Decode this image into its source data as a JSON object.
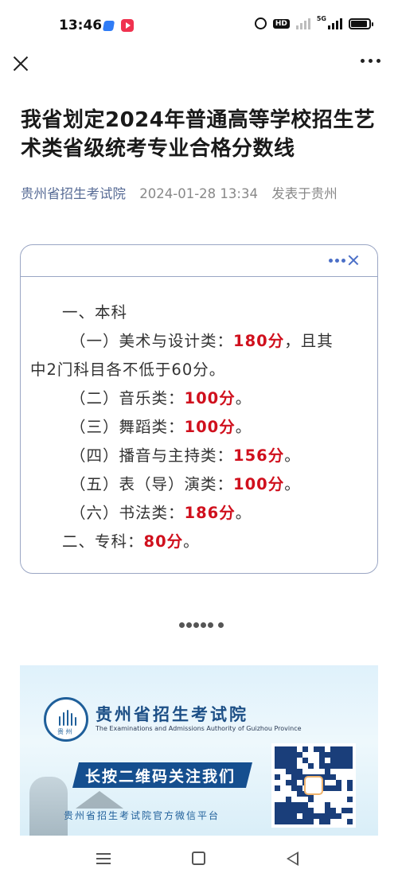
{
  "status_bar": {
    "time": "13:46",
    "hd_label": "HD",
    "network_label": "5G",
    "battery_level": 0.9
  },
  "article": {
    "title": "我省划定2024年普通高等学校招生艺术类省级统考专业合格分数线",
    "source": "贵州省招生考试院",
    "date": "2024-01-28 13:34",
    "location": "发表于贵州"
  },
  "card": {
    "lines": [
      {
        "text": "一、本科",
        "score": "",
        "suffix": ""
      },
      {
        "text": "（一）美术与设计类：",
        "score": "180分",
        "suffix": "，且其"
      },
      {
        "text": "中2门科目各不低于60分。",
        "score": "",
        "suffix": ""
      },
      {
        "text": "（二）音乐类：",
        "score": "100分",
        "suffix": "。"
      },
      {
        "text": "（三）舞蹈类：",
        "score": "100分",
        "suffix": "。"
      },
      {
        "text": "（四）播音与主持类：",
        "score": "156分",
        "suffix": "。"
      },
      {
        "text": "（五）表（导）演类：",
        "score": "100分",
        "suffix": "。"
      },
      {
        "text": "（六）书法类：",
        "score": "186分",
        "suffix": "。"
      },
      {
        "text": "二、专科：",
        "score": "80分",
        "suffix": "。"
      }
    ]
  },
  "banner": {
    "org_name": "贵州省招生考试院",
    "org_name_en": "The Examinations and Admissions Authority of Guizhou Province",
    "logo_text": "贵 州",
    "cta": "长按二维码关注我们",
    "footer": "贵州省招生考试院官方微信平台"
  },
  "colors": {
    "score": "#d0101d",
    "source_link": "#576b95",
    "card_border": "#9aa6c4",
    "brand_blue": "#154f8f"
  }
}
